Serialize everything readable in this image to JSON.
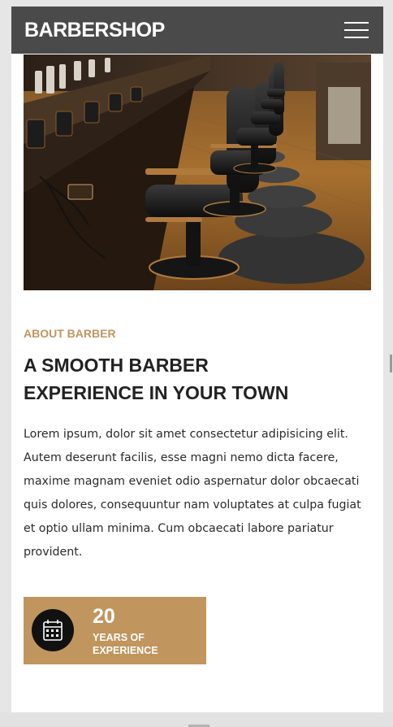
{
  "brand": {
    "name": "BARBERSHOP"
  },
  "nav": {
    "menu_icon": "hamburger-menu-icon"
  },
  "hero": {
    "image_subject": "barbershop-chairs-photo"
  },
  "about": {
    "eyebrow": "ABOUT BARBER",
    "heading_line1": "A SMOOTH BARBER",
    "heading_line2": "EXPERIENCE IN YOUR TOWN",
    "body": "Lorem ipsum, dolor sit amet consectetur adipisicing elit. Autem deserunt facilis, esse magni nemo dicta facere, maxime magnam eveniet odio aspernatur dolor obcaecati quis dolores, consequuntur nam voluptates at culpa fugiat et optio ullam minima. Cum obcaecati labore pariatur provident."
  },
  "experience": {
    "number": "20",
    "label_line1": "YEARS OF",
    "label_line2": "EXPERIENCE",
    "icon": "calendar-icon"
  },
  "colors": {
    "accent": "#c1955e",
    "navbar": "#3c3c3c",
    "heading": "#222222",
    "text": "#2a2a2a"
  }
}
